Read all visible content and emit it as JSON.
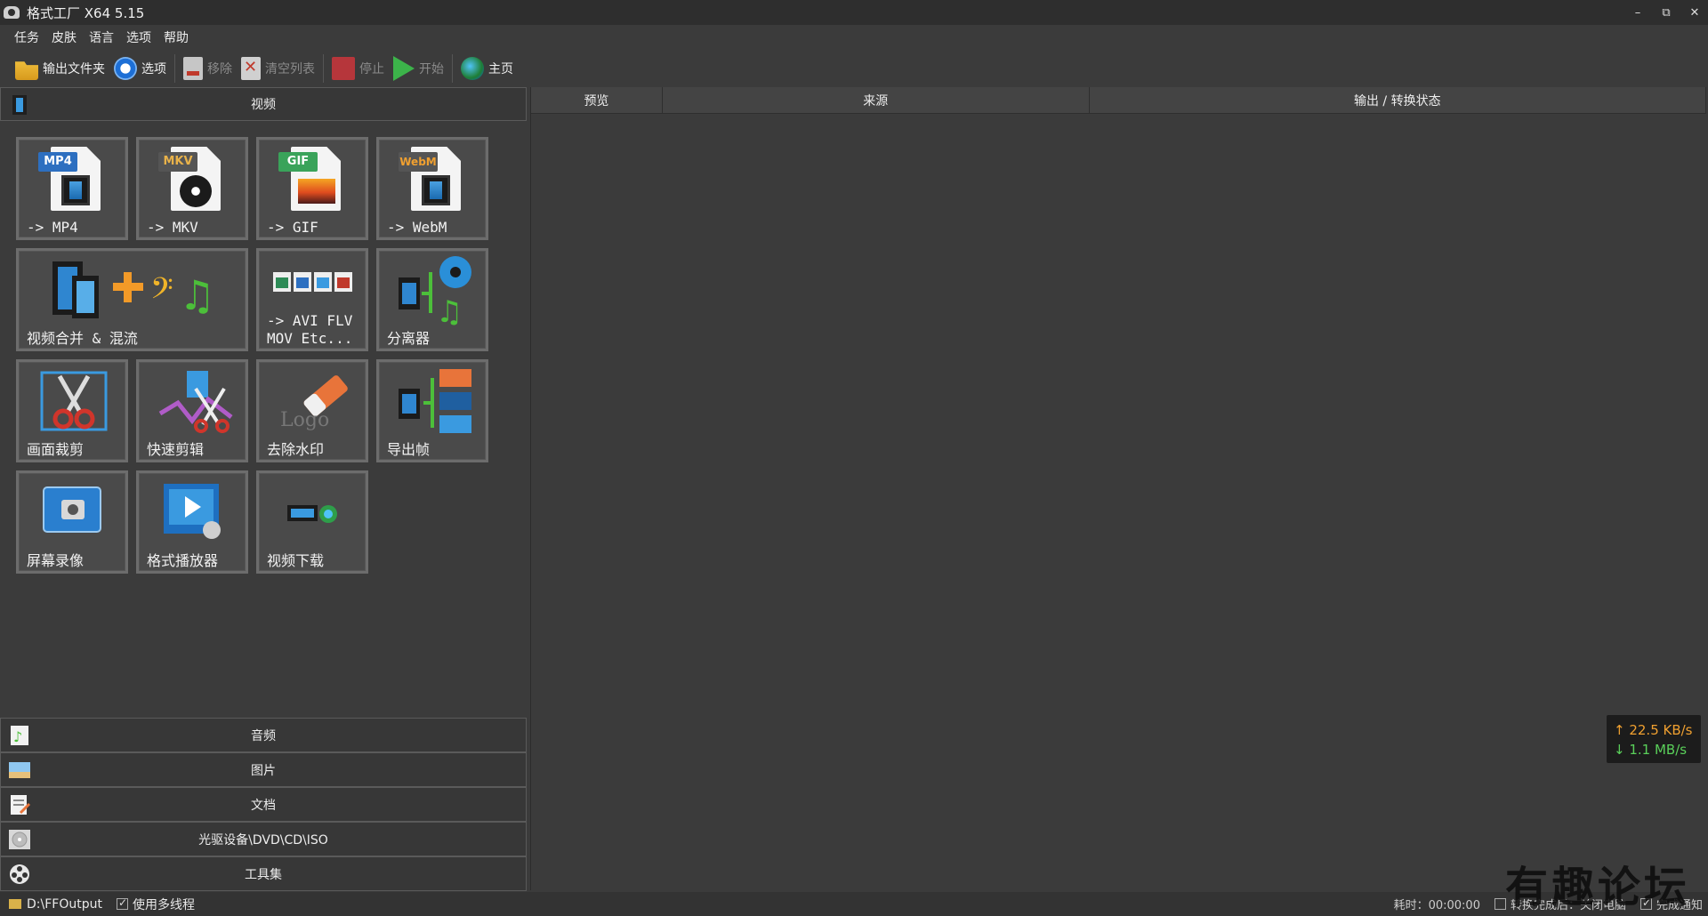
{
  "window": {
    "title": "格式工厂 X64 5.15",
    "controls": [
      "–",
      "⧉",
      "✕"
    ]
  },
  "menu": [
    "任务",
    "皮肤",
    "语言",
    "选项",
    "帮助"
  ],
  "toolbar": {
    "output_folder": "输出文件夹",
    "options": "选项",
    "remove": "移除",
    "clear_list": "清空列表",
    "stop": "停止",
    "start": "开始",
    "home": "主页"
  },
  "categories": {
    "video": "视频",
    "audio": "音频",
    "picture": "图片",
    "document": "文档",
    "optical": "光驱设备\\DVD\\CD\\ISO",
    "tools": "工具集"
  },
  "video_tiles": [
    {
      "label": "-> MP4",
      "badge": "MP4"
    },
    {
      "label": "-> MKV",
      "badge": "MKV"
    },
    {
      "label": "-> GIF",
      "badge": "GIF"
    },
    {
      "label": "-> WebM",
      "badge": "WebM"
    },
    {
      "label": "视频合并 & 混流"
    },
    {
      "label": "-> AVI FLV\nMOV Etc..."
    },
    {
      "label": "分离器"
    },
    {
      "label": "画面裁剪"
    },
    {
      "label": "快速剪辑"
    },
    {
      "label": "去除水印",
      "art_text": "Logo"
    },
    {
      "label": "导出帧"
    },
    {
      "label": "屏幕录像"
    },
    {
      "label": "格式播放器"
    },
    {
      "label": "视频下载"
    }
  ],
  "task_grid": {
    "columns": [
      "预览",
      "来源",
      "输出 / 转换状态"
    ]
  },
  "speed": {
    "up": "↑ 22.5 KB/s",
    "down": "↓ 1.1 MB/s"
  },
  "status": {
    "output_path": "D:\\FFOutput",
    "multithread": "使用多线程",
    "elapsed": "耗时：00:00:00",
    "shutdown": "转换完成后：关闭电脑",
    "notify": "完成通知"
  },
  "watermark": "有趣论坛",
  "colors": {
    "background": "#3b3b3b",
    "upload": "#f0a030",
    "download": "#5ad05a",
    "stop": "#b6363b",
    "start": "#3cb34a"
  }
}
